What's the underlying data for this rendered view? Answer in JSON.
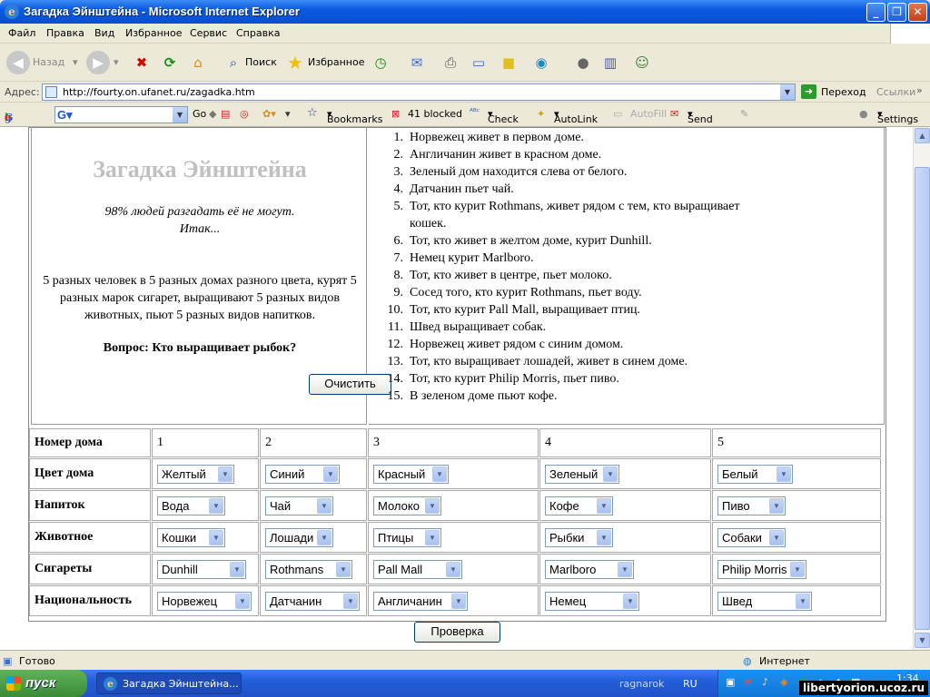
{
  "window": {
    "title": "Загадка Эйнштейна - Microsoft Internet Explorer",
    "minimize": "_",
    "maximize": "❐",
    "close": "✕"
  },
  "menu": [
    "Файл",
    "Правка",
    "Вид",
    "Избранное",
    "Сервис",
    "Справка"
  ],
  "toolbar": {
    "back": "Назад",
    "search": "Поиск",
    "favorites": "Избранное"
  },
  "address": {
    "label": "Адрес:",
    "url": "http://fourty.on.ufanet.ru/zagadka.htm",
    "go": "Переход",
    "links": "Ссылки"
  },
  "google_toolbar": {
    "logo": "Google",
    "go": "Go",
    "bookmarks": "Bookmarks",
    "blocked": "41 blocked",
    "check": "Check",
    "autolink": "AutoLink",
    "autofill": "AutoFill",
    "sendto": "Send to",
    "settings": "Settings"
  },
  "page": {
    "title": "Загадка Эйнштейна",
    "subtitle1": "98% людей разгадать её не могут.",
    "subtitle2": "Итак...",
    "description": "5 разных человек в 5 разных домах разного цвета, курят 5 разных марок сигарет, выращивают 5 разных видов животных, пьют 5 разных видов напитков.",
    "question": "Вопрос: Кто выращивает рыбок?",
    "clear_button": "Очистить",
    "check_button": "Проверка",
    "rules": [
      "Норвежец живет в первом доме.",
      "Англичанин живет в красном доме.",
      "Зеленый дом находится слева от белого.",
      "Датчанин пьет чай.",
      "Тот, кто курит Rothmans, живет рядом с тем, кто выращивает кошек.",
      "Тот, кто живет в желтом доме, курит Dunhill.",
      "Немец курит Marlboro.",
      "Тот, кто живет в центре, пьет молоко.",
      "Сосед того, кто курит Rothmans, пьет воду.",
      "Тот, кто курит Pall Mall, выращивает птиц.",
      "Швед выращивает собак.",
      "Норвежец живет рядом с синим домом.",
      "Тот, кто выращивает лошадей, живет в синем доме.",
      "Тот, кто курит Philip Morris, пьет пиво.",
      "В зеленом доме пьют кофе."
    ],
    "grid": {
      "house_label": "Номер дома",
      "houses": [
        "1",
        "2",
        "3",
        "4",
        "5"
      ],
      "rows": [
        {
          "label": "Цвет дома",
          "values": [
            "Желтый",
            "Синий",
            "Красный",
            "Зеленый",
            "Белый"
          ]
        },
        {
          "label": "Напиток",
          "values": [
            "Вода",
            "Чай",
            "Молоко",
            "Кофе",
            "Пиво"
          ]
        },
        {
          "label": "Животное",
          "values": [
            "Кошки",
            "Лошади",
            "Птицы",
            "Рыбки",
            "Собаки"
          ]
        },
        {
          "label": "Сигареты",
          "values": [
            "Dunhill",
            "Rothmans",
            "Pall Mall",
            "Marlboro",
            "Philip Morris"
          ]
        },
        {
          "label": "Национальность",
          "values": [
            "Норвежец",
            "Датчанин",
            "Англичанин",
            "Немец",
            "Швед"
          ]
        }
      ]
    }
  },
  "status": {
    "left": "Готово",
    "zone": "Интернет"
  },
  "taskbar": {
    "start": "пуск",
    "task": "Загадка Эйнштейна...",
    "user": "ragnarok",
    "lang": "RU",
    "clock": "1:34"
  },
  "watermark": "libertyorion.ucoz.ru"
}
